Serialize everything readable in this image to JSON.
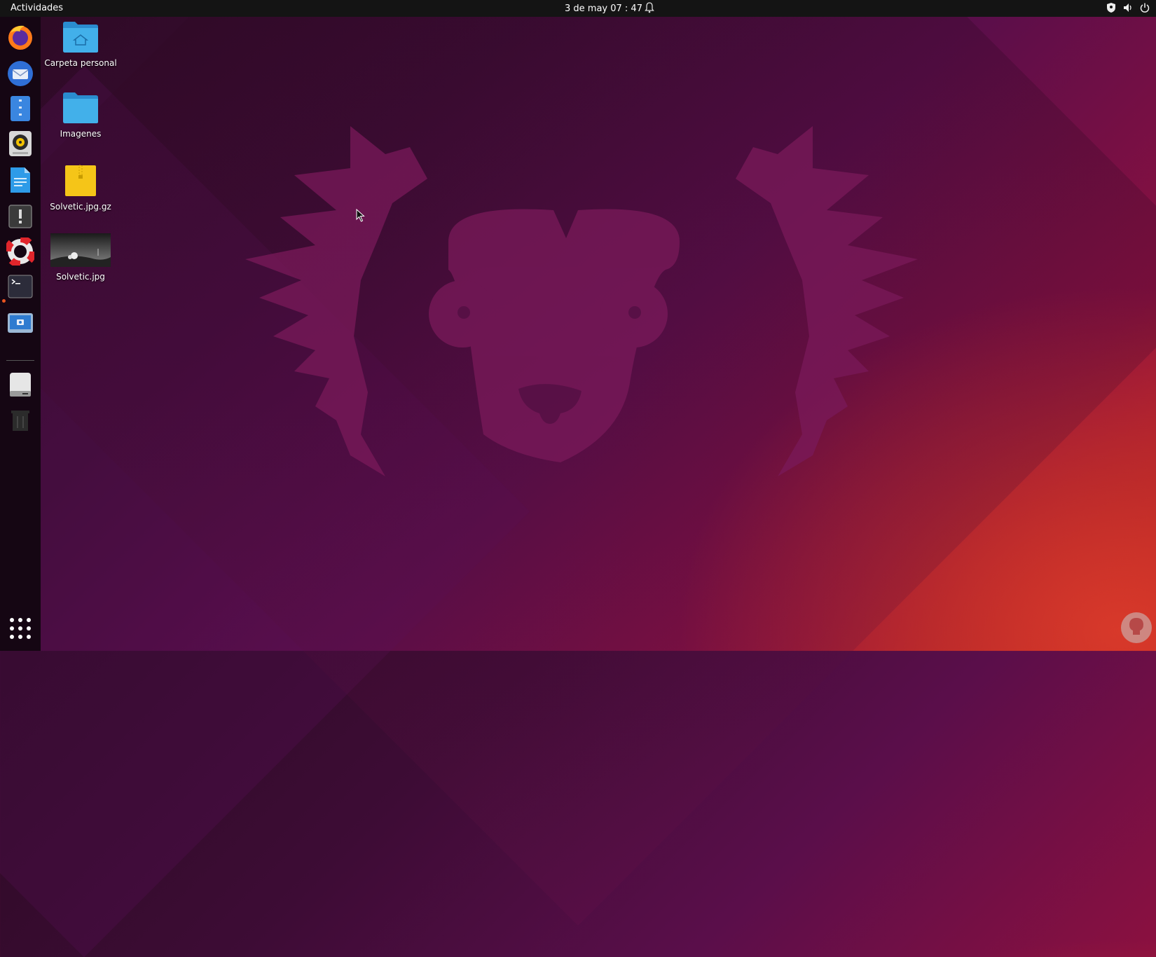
{
  "topbar": {
    "activities": "Actividades",
    "clock": "3 de may  07 : 47"
  },
  "dock": {
    "items": [
      {
        "name": "firefox"
      },
      {
        "name": "thunderbird"
      },
      {
        "name": "files"
      },
      {
        "name": "rhythmbox"
      },
      {
        "name": "libreoffice-writer"
      },
      {
        "name": "software-updater"
      },
      {
        "name": "help"
      },
      {
        "name": "terminal"
      },
      {
        "name": "screenshot"
      },
      {
        "name": "drive"
      },
      {
        "name": "trash"
      }
    ]
  },
  "desktop": {
    "icons": [
      {
        "label": "Carpeta personal"
      },
      {
        "label": "Imagenes"
      },
      {
        "label": "Solvetic.jpg.gz"
      },
      {
        "label": "Solvetic.jpg"
      }
    ]
  },
  "colors": {
    "accent": "#e95420",
    "folder": "#3aa7dd"
  }
}
